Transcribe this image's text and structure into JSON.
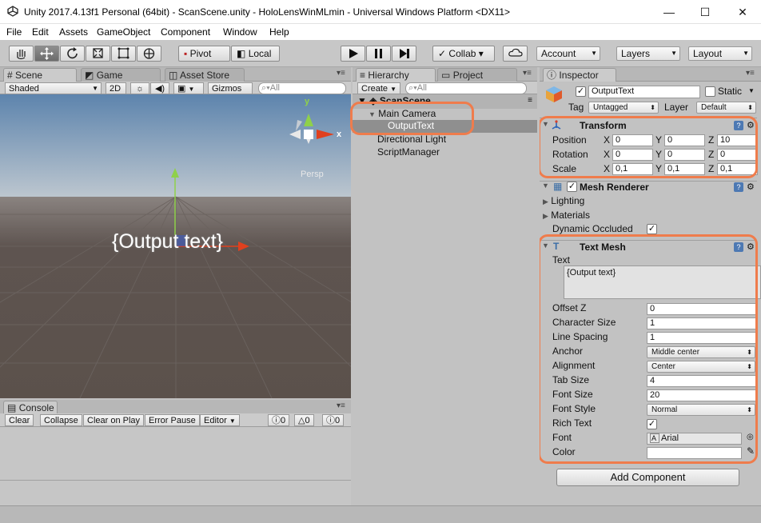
{
  "window": {
    "title": "Unity 2017.4.13f1 Personal (64bit) - ScanScene.unity - HoloLensWinMLmin - Universal Windows Platform <DX11>",
    "minimize": "—",
    "maximize": "☐",
    "close": "✕"
  },
  "menu": [
    "File",
    "Edit",
    "Assets",
    "GameObject",
    "Component",
    "Window",
    "Help"
  ],
  "toolbar": {
    "pivot": "Pivot",
    "local": "Local",
    "collab": "Collab ▾",
    "account": "Account",
    "layers": "Layers",
    "layout": "Layout"
  },
  "scene": {
    "tabs": [
      "Scene",
      "Game",
      "Asset Store"
    ],
    "shading": "Shaded",
    "mode2d": "2D",
    "gizmos": "Gizmos",
    "search_placeholder": "All",
    "persp": "Persp",
    "axis_y": "y",
    "axis_x": "x",
    "object_text": "{Output text}"
  },
  "console": {
    "tab": "Console",
    "buttons": [
      "Clear",
      "Collapse",
      "Clear on Play",
      "Error Pause",
      "Editor"
    ],
    "counts": [
      "0",
      "0",
      "0"
    ]
  },
  "hierarchy": {
    "tabs": [
      "Hierarchy",
      "Project"
    ],
    "create": "Create",
    "search_placeholder": "All",
    "scene_name": "ScanScene",
    "items": [
      "Main Camera",
      "OutputText",
      "Directional Light",
      "ScriptManager"
    ]
  },
  "inspector": {
    "tab": "Inspector",
    "object_name": "OutputText",
    "static": "Static",
    "tag_label": "Tag",
    "tag_value": "Untagged",
    "layer_label": "Layer",
    "layer_value": "Default",
    "transform": {
      "title": "Transform",
      "rows": [
        {
          "label": "Position",
          "x": "0",
          "y": "0",
          "z": "10"
        },
        {
          "label": "Rotation",
          "x": "0",
          "y": "0",
          "z": "0"
        },
        {
          "label": "Scale",
          "x": "0,1",
          "y": "0,1",
          "z": "0,1"
        }
      ],
      "axis_x": "X",
      "axis_y": "Y",
      "axis_z": "Z"
    },
    "mesh_renderer": {
      "title": "Mesh Renderer",
      "lighting": "Lighting",
      "materials": "Materials",
      "dynamic_occluded": "Dynamic Occluded"
    },
    "text_mesh": {
      "title": "Text Mesh",
      "text_label": "Text",
      "text_value": "{Output text}",
      "props": [
        {
          "label": "Offset Z",
          "value": "0",
          "kind": "field"
        },
        {
          "label": "Character Size",
          "value": "1",
          "kind": "field"
        },
        {
          "label": "Line Spacing",
          "value": "1",
          "kind": "field"
        },
        {
          "label": "Anchor",
          "value": "Middle center",
          "kind": "drop"
        },
        {
          "label": "Alignment",
          "value": "Center",
          "kind": "drop"
        },
        {
          "label": "Tab Size",
          "value": "4",
          "kind": "field"
        },
        {
          "label": "Font Size",
          "value": "20",
          "kind": "field"
        },
        {
          "label": "Font Style",
          "value": "Normal",
          "kind": "drop"
        },
        {
          "label": "Rich Text",
          "value": "",
          "kind": "check"
        },
        {
          "label": "Font",
          "value": "Arial",
          "kind": "font"
        },
        {
          "label": "Color",
          "value": "",
          "kind": "color"
        }
      ]
    },
    "add_component": "Add Component"
  },
  "colors": {
    "highlight": "#ef7c4c",
    "selection": "#8f8f8f",
    "sky": "#6e93b8",
    "ground": "#5d524c"
  }
}
